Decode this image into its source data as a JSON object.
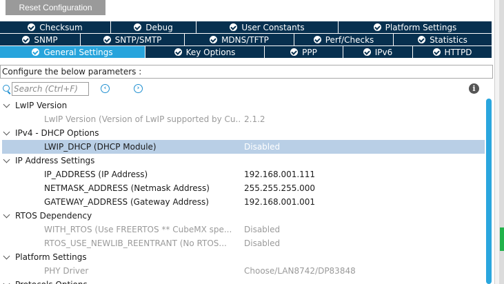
{
  "toolbar": {
    "reset_label": "Reset Configuration"
  },
  "tabs": {
    "row1": [
      {
        "label": "Checksum"
      },
      {
        "label": "Debug"
      },
      {
        "label": "User Constants"
      },
      {
        "label": "Platform Settings"
      }
    ],
    "row2": [
      {
        "label": "SNMP"
      },
      {
        "label": "SNTP/SMTP"
      },
      {
        "label": "MDNS/TFTP"
      },
      {
        "label": "Perf/Checks"
      },
      {
        "label": "Statistics"
      }
    ],
    "row3": [
      {
        "label": "General Settings",
        "active": true
      },
      {
        "label": "Key Options"
      },
      {
        "label": "PPP"
      },
      {
        "label": "IPv6"
      },
      {
        "label": "HTTPD"
      }
    ]
  },
  "config_label": "Configure the below parameters :",
  "search": {
    "placeholder": "Search (Ctrl+F)",
    "prev_icon": "chevron-left-circle-icon",
    "next_icon": "chevron-right-circle-icon",
    "info_icon": "info-icon"
  },
  "tree": {
    "groups": [
      {
        "label": "LwIP Version",
        "params": [
          {
            "name": "LwIP Version (Version of LwIP supported by Cu...",
            "value": "2.1.2",
            "disabled": true
          }
        ]
      },
      {
        "label": "IPv4 - DHCP Options",
        "params": [
          {
            "name": "LWIP_DHCP (DHCP Module)",
            "value": "Disabled",
            "selected": true
          }
        ]
      },
      {
        "label": "IP Address Settings",
        "params": [
          {
            "name": "IP_ADDRESS (IP Address)",
            "value": "192.168.001.111"
          },
          {
            "name": "NETMASK_ADDRESS (Netmask Address)",
            "value": "255.255.255.000"
          },
          {
            "name": "GATEWAY_ADDRESS (Gateway Address)",
            "value": "192.168.001.001"
          }
        ]
      },
      {
        "label": "RTOS Dependency",
        "params": [
          {
            "name": "WITH_RTOS (Use FREERTOS ** CubeMX spe...",
            "value": "Disabled",
            "disabled": true
          },
          {
            "name": "RTOS_USE_NEWLIB_REENTRANT (No RTOS...",
            "value": "Disabled",
            "disabled": true
          }
        ]
      },
      {
        "label": "Platform Settings",
        "params": [
          {
            "name": "PHY Driver",
            "value": "Choose/LAN8742/DP83848",
            "disabled": true
          }
        ]
      },
      {
        "label": "Protocols Options",
        "params": []
      }
    ]
  },
  "colors": {
    "tab_bg": "#07304f",
    "tab_active": "#27a4dc",
    "selected_row": "#b9cfe6",
    "scrollbar": "#2aa6de"
  }
}
